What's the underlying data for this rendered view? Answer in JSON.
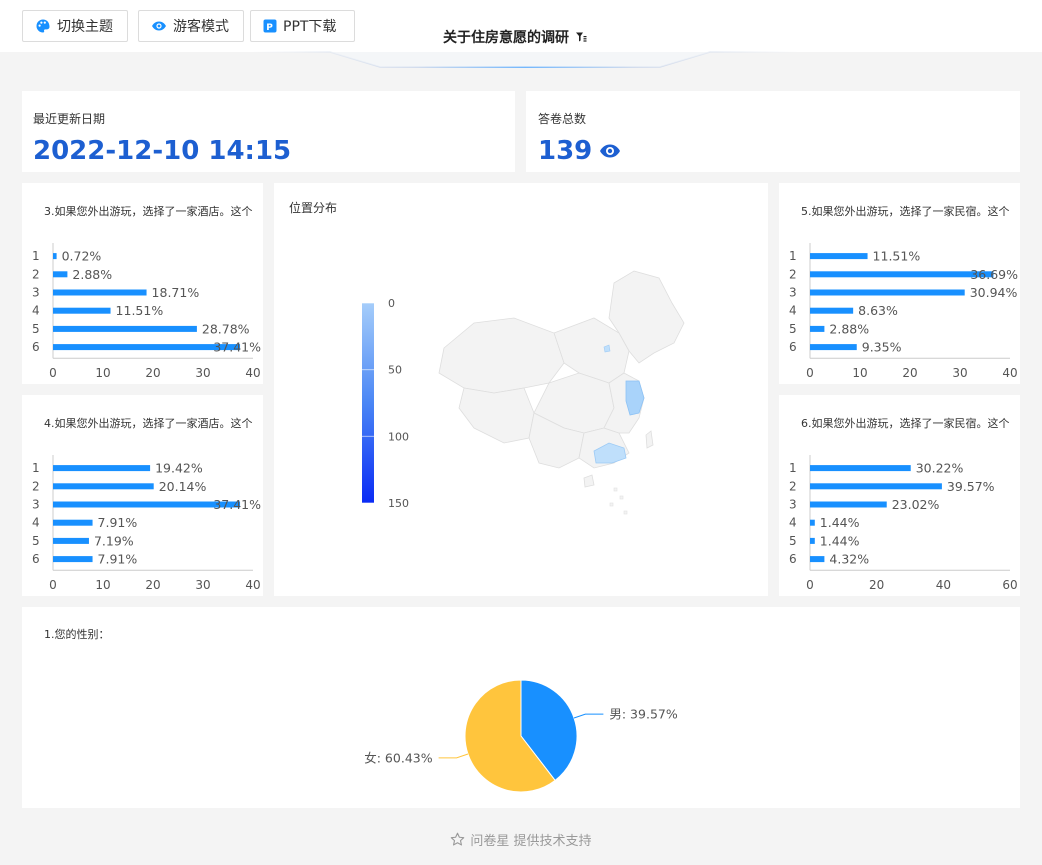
{
  "toolbar": {
    "theme_label": "切换主题",
    "guest_label": "游客模式",
    "ppt_label": "PPT下载"
  },
  "header": {
    "title": "关于住房意愿的调研"
  },
  "stats": {
    "updated_label": "最近更新日期",
    "updated_value": "2022-12-10 14:15",
    "total_label": "答卷总数",
    "total_value": "139"
  },
  "map": {
    "title": "位置分布"
  },
  "footer": {
    "text": "问卷星 提供技术支持"
  },
  "colors": {
    "accent": "#1d5fd1",
    "bar": "#1890ff",
    "male": "#1890ff",
    "female": "#ffc53d"
  },
  "chart_data": [
    {
      "id": "q3",
      "type": "bar",
      "title": "3.如果您外出游玩，选择了一家酒店。这个",
      "categories": [
        "1",
        "2",
        "3",
        "4",
        "5",
        "6"
      ],
      "values": [
        0.72,
        2.88,
        18.71,
        11.51,
        28.78,
        37.41
      ],
      "labels": [
        "0.72%",
        "2.88%",
        "18.71%",
        "11.51%",
        "28.78%",
        "37.41%"
      ],
      "ticks": [
        "0",
        "10",
        "20",
        "30",
        "40"
      ],
      "xlim": [
        0,
        40
      ]
    },
    {
      "id": "q4",
      "type": "bar",
      "title": "4.如果您外出游玩，选择了一家酒店。这个",
      "categories": [
        "1",
        "2",
        "3",
        "4",
        "5",
        "6"
      ],
      "values": [
        19.42,
        20.14,
        37.41,
        7.91,
        7.19,
        7.91
      ],
      "labels": [
        "19.42%",
        "20.14%",
        "37.41%",
        "7.91%",
        "7.19%",
        "7.91%"
      ],
      "ticks": [
        "0",
        "10",
        "20",
        "30",
        "40"
      ],
      "xlim": [
        0,
        40
      ]
    },
    {
      "id": "q5",
      "type": "bar",
      "title": "5.如果您外出游玩，选择了一家民宿。这个",
      "categories": [
        "1",
        "2",
        "3",
        "4",
        "5",
        "6"
      ],
      "values": [
        11.51,
        36.69,
        30.94,
        8.63,
        2.88,
        9.35
      ],
      "labels": [
        "11.51%",
        "36.69%",
        "30.94%",
        "8.63%",
        "2.88%",
        "9.35%"
      ],
      "ticks": [
        "0",
        "10",
        "20",
        "30",
        "40"
      ],
      "xlim": [
        0,
        40
      ]
    },
    {
      "id": "q6",
      "type": "bar",
      "title": "6.如果您外出游玩，选择了一家民宿。这个",
      "categories": [
        "1",
        "2",
        "3",
        "4",
        "5",
        "6"
      ],
      "values": [
        30.22,
        39.57,
        23.02,
        1.44,
        1.44,
        4.32
      ],
      "labels": [
        "30.22%",
        "39.57%",
        "23.02%",
        "1.44%",
        "1.44%",
        "4.32%"
      ],
      "ticks": [
        "0",
        "20",
        "40",
        "60"
      ],
      "xlim": [
        0,
        60
      ]
    },
    {
      "id": "q1",
      "type": "pie",
      "title": "1.您的性别：",
      "slices": [
        {
          "name": "男",
          "value": 39.57,
          "label": "男: 39.57%",
          "color": "#1890ff"
        },
        {
          "name": "女",
          "value": 60.43,
          "label": "女: 60.43%",
          "color": "#ffc53d"
        }
      ]
    },
    {
      "id": "map",
      "type": "heatmap",
      "title": "位置分布",
      "legend_ticks": [
        "0",
        "50",
        "100",
        "150"
      ],
      "range": [
        0,
        150
      ]
    }
  ]
}
